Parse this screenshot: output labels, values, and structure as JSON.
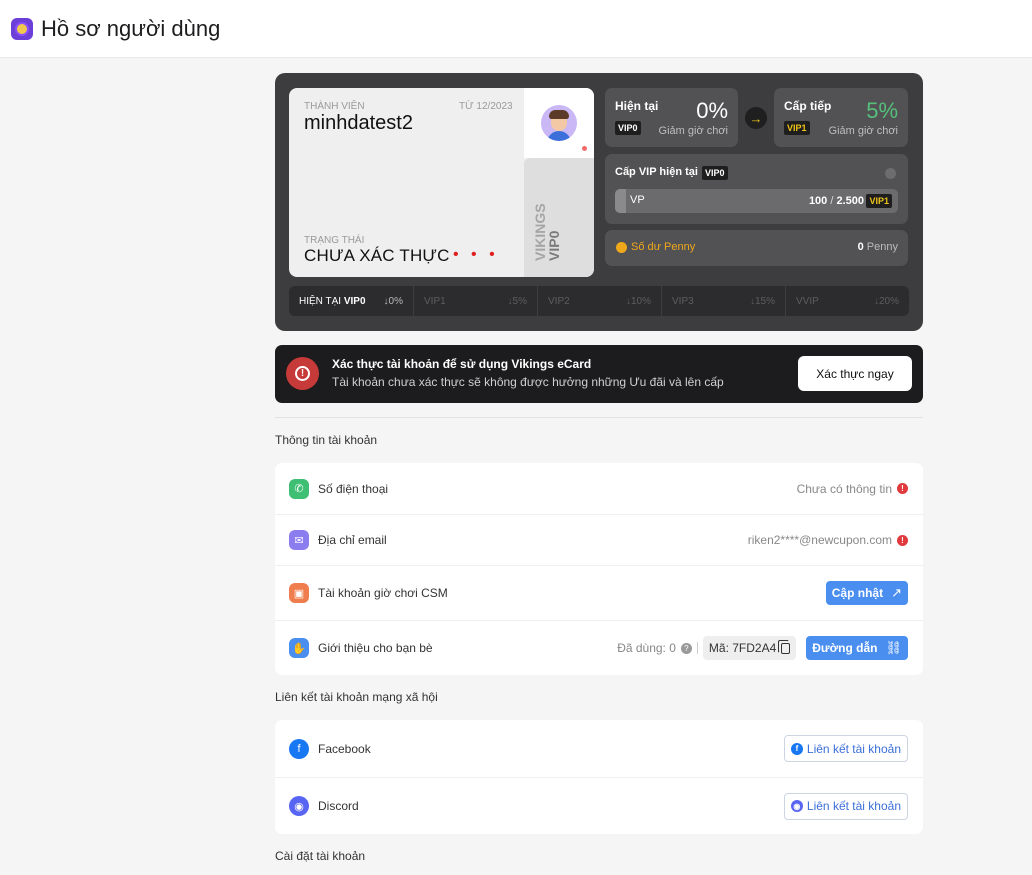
{
  "header": {
    "title": "Hồ sơ người dùng",
    "logo_icon": "profile-logo-icon"
  },
  "member_card": {
    "member_label": "THÀNH VIÊN",
    "since": "TỪ 12/2023",
    "username": "minhdatest2",
    "status_label": "TRẠNG THÁI",
    "status": "CHƯA XÁC THỰC",
    "dots": "• • •",
    "brand_line1": "VIKINGS",
    "brand_line2": "VIP0"
  },
  "tier_current": {
    "title": "Hiện tại",
    "percent": "0%",
    "badge": "VIP0",
    "sub": "Giảm giờ chơi"
  },
  "tier_next": {
    "title": "Cấp tiếp",
    "percent": "5%",
    "badge": "VIP1",
    "sub": "Giảm giờ chơi"
  },
  "vip_progress": {
    "title": "Cấp VIP hiện tại",
    "badge": "VIP0",
    "label": "VP",
    "current": "100",
    "separator": " / ",
    "target": "2.500",
    "next_badge": "VIP1",
    "progress_fraction": 0.04
  },
  "penny": {
    "label": "Số dư Penny",
    "value": "0",
    "unit": "Penny"
  },
  "tier_strip": [
    {
      "name": "HIỆN TẠI",
      "badge": "VIP0",
      "pct": "↓0%"
    },
    {
      "name": "VIP1",
      "badge": "",
      "pct": "↓5%"
    },
    {
      "name": "VIP2",
      "badge": "",
      "pct": "↓10%"
    },
    {
      "name": "VIP3",
      "badge": "",
      "pct": "↓15%"
    },
    {
      "name": "VVIP",
      "badge": "",
      "pct": "↓20%"
    }
  ],
  "verify_banner": {
    "title": "Xác thực tài khoản để sử dụng Vikings eCard",
    "subtitle": "Tài khoản chưa xác thực sẽ không được hưởng những Ưu đãi và lên cấp",
    "button": "Xác thực ngay"
  },
  "account_info": {
    "section_title": "Thông tin tài khoản",
    "phone": {
      "label": "Số điện thoại",
      "value": "Chưa có thông tin"
    },
    "email": {
      "label": "Địa chỉ email",
      "value": "riken2****@newcupon.com"
    },
    "csm": {
      "label": "Tài khoản giờ chơi CSM",
      "button": "Cập nhật"
    },
    "referral": {
      "label": "Giới thiệu cho bạn bè",
      "used": "Đã dùng: 0",
      "code": "Mã: 7FD2A4",
      "button": "Đường dẫn"
    }
  },
  "social": {
    "section_title": "Liên kết tài khoản mạng xã hội",
    "facebook": {
      "label": "Facebook",
      "button": "Liên kết tài khoản"
    },
    "discord": {
      "label": "Discord",
      "button": "Liên kết tài khoản"
    }
  },
  "settings": {
    "section_title": "Cài đặt tài khoản"
  },
  "colors": {
    "accent_blue": "#4a8ff0",
    "warning_red": "#e0393e",
    "vip_gold": "#f0c419",
    "next_green": "#55c07b",
    "penny_orange": "#f0a81b"
  }
}
